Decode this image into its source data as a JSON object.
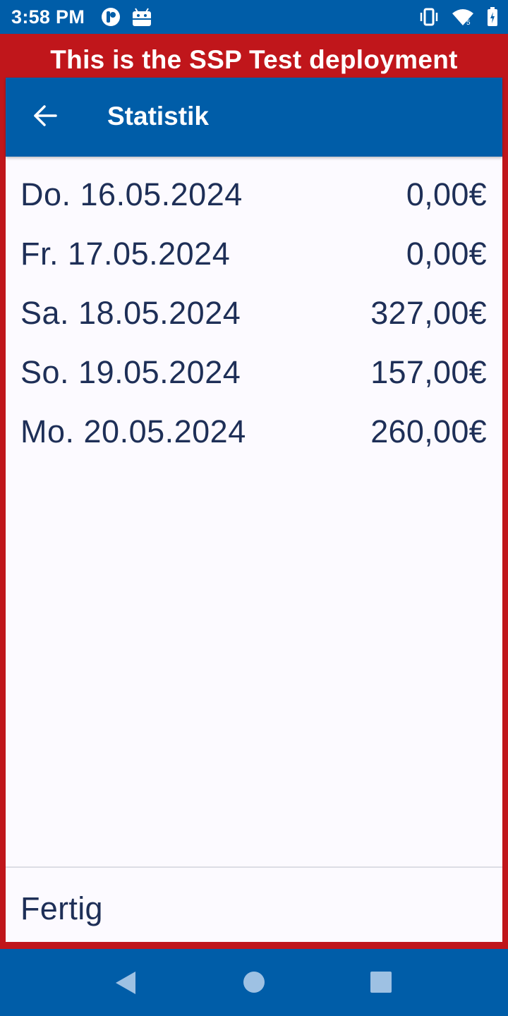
{
  "status_bar": {
    "time": "3:58 PM",
    "left_icons": [
      "app-notification-icon",
      "android-debug-icon"
    ],
    "right_icons": [
      "vibrate-icon",
      "wifi-icon",
      "battery-charging-icon"
    ]
  },
  "banner": {
    "text": "This is the SSP Test deployment",
    "color": "#c0161b"
  },
  "app_bar": {
    "title": "Statistik",
    "back_icon": "arrow-back-icon",
    "color": "#005da8"
  },
  "stats": [
    {
      "date": "Do. 16.05.2024",
      "amount": "0,00€"
    },
    {
      "date": "Fr. 17.05.2024",
      "amount": "0,00€"
    },
    {
      "date": "Sa. 18.05.2024",
      "amount": "327,00€"
    },
    {
      "date": "So. 19.05.2024",
      "amount": "157,00€"
    },
    {
      "date": "Mo. 20.05.2024",
      "amount": "260,00€"
    }
  ],
  "footer": {
    "done_label": "Fertig"
  },
  "nav_bar": {
    "icons": [
      "nav-back-icon",
      "nav-home-icon",
      "nav-recents-icon"
    ]
  }
}
